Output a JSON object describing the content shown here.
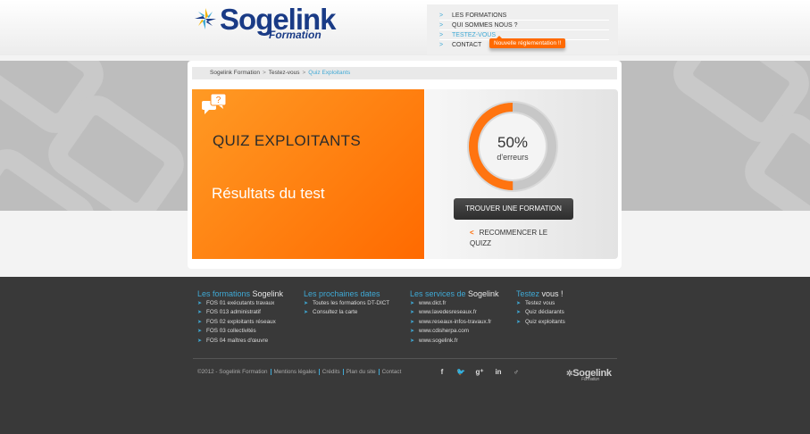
{
  "brand": {
    "name": "Sogelink",
    "sub": "Formation"
  },
  "nav": {
    "arrow": ">",
    "items": [
      "LES FORMATIONS",
      "QUI SOMMES NOUS ?",
      "TESTEZ-VOUS",
      "CONTACT"
    ],
    "active_index": 2,
    "badge": "Nouvelle réglementation !!"
  },
  "breadcrumb": {
    "items": [
      "Sogelink Formation",
      "Testez-vous",
      "Quiz Exploitants"
    ],
    "sep": ">"
  },
  "quiz": {
    "title": "QUIZ EXPLOITANTS",
    "subtitle": "Résultats du test",
    "icon": "speech-bubbles-question-icon"
  },
  "result": {
    "percent": "50%",
    "percent_value": 50,
    "label": "d'erreurs",
    "find_button": "TROUVER UNE FORMATION",
    "restart_label": "RECOMMENCER LE QUIZZ"
  },
  "footer": {
    "columns": [
      {
        "h1": "Les formations",
        "h2": " Sogelink",
        "items": [
          "FOS 01 exécutants travaux",
          "FOS 013 administratif",
          "FOS 02 exploitants réseaux",
          "FOS 03 collectivités",
          "FOS 04 maîtres d'œuvre"
        ]
      },
      {
        "h1": "Les prochaines dates",
        "h2": "",
        "items": [
          "Toutes les formations DT-DICT",
          "Consultez la carte"
        ]
      },
      {
        "h1": "Les services de",
        "h2": " Sogelink",
        "items": [
          "www.dict.fr",
          "www.lavedesreseaux.fr",
          "www.reseaux-infos-travaux.fr",
          "www.cdisherpa.com",
          "www.sogelink.fr"
        ]
      },
      {
        "h1": "Testez",
        "h2": " vous !",
        "items": [
          "Testez vous",
          "Quiz déclarants",
          "Quiz exploitants"
        ]
      }
    ],
    "bullet": "➤",
    "legal": [
      "©2012 - Sogelink Formation",
      "Mentions légales",
      "Crédits",
      "Plan du site",
      "Contact"
    ],
    "social": [
      "f",
      "🐦",
      "g⁺",
      "in",
      "♂"
    ],
    "logo": "Sogelink",
    "logo_sub": "Formation"
  },
  "colors": {
    "accent": "#3fa9d5",
    "orange": "#ff6a00",
    "brand_blue": "#1a3b86"
  }
}
